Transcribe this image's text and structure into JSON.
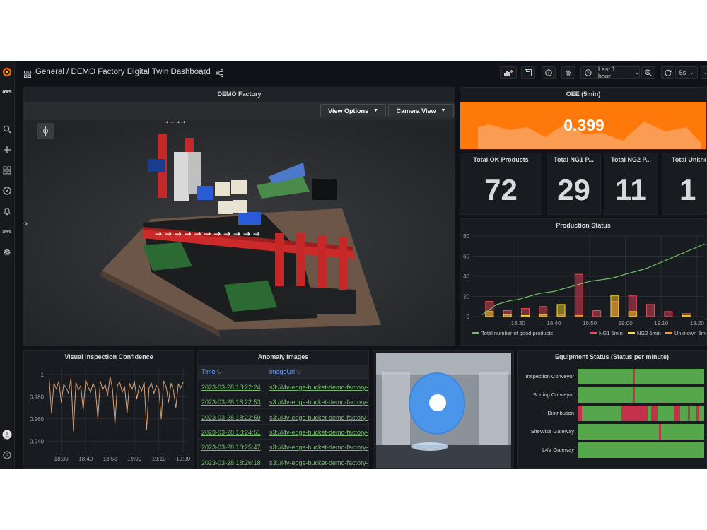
{
  "breadcrumb": {
    "root": "General",
    "title": "/ DEMO Factory Digital Twin Dashboard"
  },
  "toolbar": {
    "time_range": "Last 1 hour",
    "refresh": "5s"
  },
  "factory": {
    "title": "DEMO Factory",
    "view_options": "View Options",
    "camera_view": "Camera View"
  },
  "oee": {
    "title": "OEE (5min)",
    "value": "0.399",
    "color": "#ff780a"
  },
  "stats": [
    {
      "title": "Total OK Products",
      "value": "72"
    },
    {
      "title": "Total NG1 P...",
      "value": "29"
    },
    {
      "title": "Total NG2 P...",
      "value": "11"
    },
    {
      "title": "Total Unkno...",
      "value": "1"
    }
  ],
  "inspection": {
    "title": "Visual Inspection Confidence"
  },
  "anomaly": {
    "title": "Anomaly Images",
    "col_time": "Time",
    "col_uri": "imageUri",
    "rows": [
      {
        "time": "2023-03-28 18:22:24",
        "uri": "s3://l4v-edge-bucket-demo-factory-u"
      },
      {
        "time": "2023-03-28 18:22:53",
        "uri": "s3://l4v-edge-bucket-demo-factory-u"
      },
      {
        "time": "2023-03-28 18:22:59",
        "uri": "s3://l4v-edge-bucket-demo-factory-u"
      },
      {
        "time": "2023-03-28 18:24:51",
        "uri": "s3://l4v-edge-bucket-demo-factory-u"
      },
      {
        "time": "2023-03-28 18:25:47",
        "uri": "s3://l4v-edge-bucket-demo-factory-u"
      },
      {
        "time": "2023-03-28 18:26:18",
        "uri": "s3://l4v-edge-bucket-demo-factory-u"
      }
    ]
  },
  "equipment": {
    "title": "Equipment Status (Status per minute)",
    "good_color": "#56a64b",
    "bad_color": "#c4314b",
    "rows": [
      {
        "name": "Inspection Conveyor",
        "faults": [
          [
            0.43,
            0.45
          ]
        ]
      },
      {
        "name": "Sorting Conveyor",
        "faults": [
          [
            0.43,
            0.45
          ]
        ]
      },
      {
        "name": "Distribution",
        "faults": [
          [
            0.0,
            0.03
          ],
          [
            0.34,
            0.55
          ],
          [
            0.58,
            0.63
          ],
          [
            0.76,
            0.81
          ],
          [
            0.87,
            0.89
          ],
          [
            0.94,
            0.96
          ]
        ]
      },
      {
        "name": "SiteWise Gateway",
        "faults": [
          [
            0.64,
            0.66
          ]
        ]
      },
      {
        "name": "L4V Gateway",
        "faults": []
      }
    ]
  },
  "chart_data": [
    {
      "type": "bar",
      "title": "Production Status",
      "ylim": [
        0,
        80
      ],
      "yticks": [
        0,
        20,
        40,
        60,
        80
      ],
      "x_range": [
        "18:17",
        "19:22"
      ],
      "xticks": [
        "18:30",
        "18:40",
        "18:50",
        "19:00",
        "19:10",
        "19:20"
      ],
      "legend": "bottom",
      "series": [
        {
          "name": "Total number of good products",
          "kind": "line",
          "color": "#73bf69",
          "x": [
            "18:20",
            "18:22",
            "18:24",
            "18:26",
            "18:28",
            "18:30",
            "18:32",
            "18:34",
            "18:36",
            "18:38",
            "18:40",
            "18:42",
            "18:44",
            "18:46",
            "18:48",
            "18:50",
            "18:52",
            "18:54",
            "18:56",
            "18:58",
            "19:00",
            "19:02",
            "19:04",
            "19:06",
            "19:08",
            "19:10",
            "19:12",
            "19:14",
            "19:16",
            "19:18",
            "19:20",
            "19:22"
          ],
          "values": [
            2,
            7,
            12,
            14,
            16,
            17,
            19,
            21,
            23,
            24,
            25,
            27,
            29,
            31,
            33,
            35,
            36,
            37,
            38,
            40,
            42,
            44,
            46,
            48,
            51,
            54,
            57,
            60,
            63,
            66,
            69,
            72
          ]
        },
        {
          "name": "NG1 5min",
          "kind": "bar",
          "color": "#f2495c",
          "x": [
            "18:22",
            "18:27",
            "18:32",
            "18:37",
            "18:42",
            "18:47",
            "18:52",
            "18:57",
            "19:02",
            "19:07",
            "19:12",
            "19:17"
          ],
          "values": [
            15,
            6,
            8,
            10,
            2,
            42,
            6,
            15,
            21,
            12,
            5,
            3
          ]
        },
        {
          "name": "NG2 5min",
          "kind": "bar",
          "color": "#fade2a",
          "x": [
            "18:22",
            "18:27",
            "18:32",
            "18:37",
            "18:42",
            "18:47",
            "18:52",
            "18:57",
            "19:02",
            "19:07",
            "19:12",
            "19:17"
          ],
          "values": [
            5,
            2,
            1,
            2,
            12,
            0,
            0,
            21,
            5,
            0,
            0,
            1
          ]
        },
        {
          "name": "Unknown 5min",
          "kind": "bar",
          "color": "#ff9830",
          "x": [
            "18:22",
            "18:27",
            "18:32",
            "18:37",
            "18:42",
            "18:47",
            "18:52",
            "18:57",
            "19:02",
            "19:07",
            "19:12",
            "19:17"
          ],
          "values": [
            0,
            0,
            0,
            0,
            0,
            1,
            0,
            0,
            0,
            0,
            0,
            0
          ]
        }
      ]
    },
    {
      "type": "line",
      "title": "Visual Inspection Confidence",
      "ylim": [
        0.93,
        1.005
      ],
      "yticks": [
        1,
        0.98,
        0.96,
        0.94
      ],
      "ytick_labels": [
        "1",
        "0.980",
        "0.960",
        "0.940"
      ],
      "x_range": [
        "18:24",
        "19:22"
      ],
      "xticks": [
        "18:30",
        "18:40",
        "18:50",
        "19:00",
        "19:10",
        "19:20"
      ],
      "series": [
        {
          "name": "confidence",
          "color": "#d6a076",
          "x": [
            "18:25",
            "18:26",
            "18:27",
            "18:28",
            "18:29",
            "18:30",
            "18:31",
            "18:32",
            "18:33",
            "18:34",
            "18:35",
            "18:36",
            "18:37",
            "18:38",
            "18:39",
            "18:40",
            "18:41",
            "18:42",
            "18:43",
            "18:44",
            "18:45",
            "18:46",
            "18:47",
            "18:48",
            "18:49",
            "18:50",
            "18:51",
            "18:52",
            "18:53",
            "18:54",
            "18:55",
            "18:56",
            "18:57",
            "18:58",
            "18:59",
            "19:00",
            "19:01",
            "19:02",
            "19:03",
            "19:04",
            "19:05",
            "19:06",
            "19:07",
            "19:08",
            "19:09",
            "19:10",
            "19:11",
            "19:12",
            "19:13",
            "19:14",
            "19:15",
            "19:16",
            "19:17",
            "19:18",
            "19:19",
            "19:20"
          ],
          "values": [
            0.998,
            0.965,
            0.992,
            0.987,
            0.994,
            0.975,
            0.991,
            0.988,
            0.983,
            0.997,
            0.949,
            0.993,
            0.986,
            0.99,
            0.968,
            0.995,
            0.989,
            0.984,
            0.992,
            0.987,
            0.96,
            0.994,
            0.986,
            0.991,
            0.981,
            0.998,
            0.987,
            0.955,
            0.99,
            0.993,
            0.984,
            0.989,
            0.965,
            0.992,
            0.986,
            0.994,
            0.978,
            0.99,
            0.985,
            0.993,
            0.95,
            0.988,
            0.992,
            0.983,
            0.99,
            0.987,
            0.96,
            0.994,
            0.989,
            0.975,
            0.992,
            0.986,
            0.97,
            0.991,
            0.988,
            0.993
          ]
        }
      ]
    }
  ]
}
